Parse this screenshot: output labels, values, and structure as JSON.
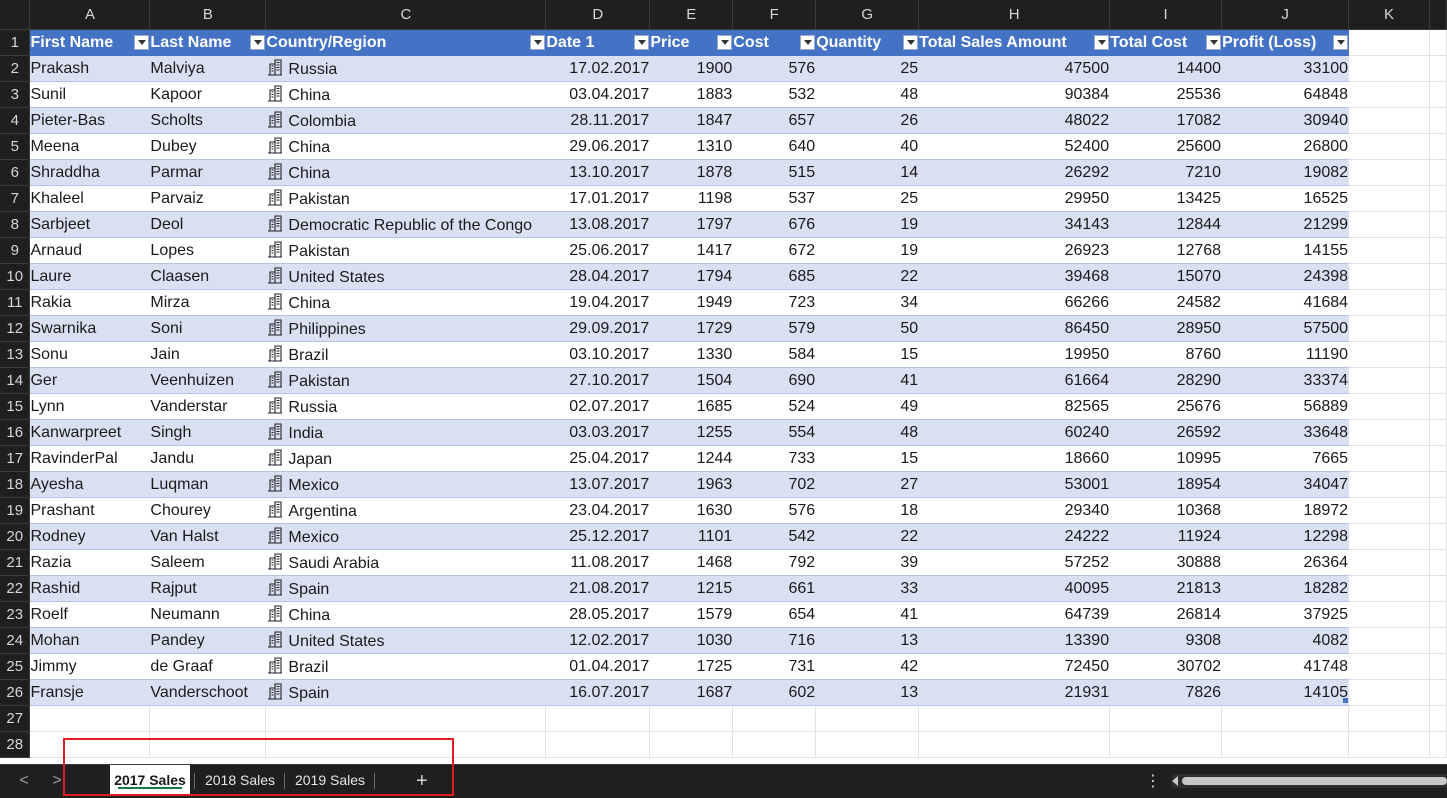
{
  "columns": [
    "A",
    "B",
    "C",
    "D",
    "E",
    "F",
    "G",
    "H",
    "I",
    "J",
    "K"
  ],
  "row_numbers": [
    "1",
    "2",
    "3",
    "4",
    "5",
    "6",
    "7",
    "8",
    "9",
    "10",
    "11",
    "12",
    "13",
    "14",
    "15",
    "16",
    "17",
    "18",
    "19",
    "20",
    "21",
    "22",
    "23",
    "24",
    "25",
    "26",
    "27",
    "28"
  ],
  "table": {
    "headers": [
      "First Name",
      "Last Name",
      "Country/Region",
      "Date 1",
      "Price",
      "Cost",
      "Quantity",
      "Total Sales Amount",
      "Total Cost",
      "Profit (Loss)"
    ],
    "rows": [
      [
        "Prakash",
        "Malviya",
        "Russia",
        "17.02.2017",
        "1900",
        "576",
        "25",
        "47500",
        "14400",
        "33100"
      ],
      [
        "Sunil",
        "Kapoor",
        "China",
        "03.04.2017",
        "1883",
        "532",
        "48",
        "90384",
        "25536",
        "64848"
      ],
      [
        "Pieter-Bas",
        "Scholts",
        "Colombia",
        "28.11.2017",
        "1847",
        "657",
        "26",
        "48022",
        "17082",
        "30940"
      ],
      [
        "Meena",
        "Dubey",
        "China",
        "29.06.2017",
        "1310",
        "640",
        "40",
        "52400",
        "25600",
        "26800"
      ],
      [
        "Shraddha",
        "Parmar",
        "China",
        "13.10.2017",
        "1878",
        "515",
        "14",
        "26292",
        "7210",
        "19082"
      ],
      [
        "Khaleel",
        "Parvaiz",
        "Pakistan",
        "17.01.2017",
        "1198",
        "537",
        "25",
        "29950",
        "13425",
        "16525"
      ],
      [
        "Sarbjeet",
        "Deol",
        "Democratic Republic of the Congo",
        "13.08.2017",
        "1797",
        "676",
        "19",
        "34143",
        "12844",
        "21299"
      ],
      [
        "Arnaud",
        "Lopes",
        "Pakistan",
        "25.06.2017",
        "1417",
        "672",
        "19",
        "26923",
        "12768",
        "14155"
      ],
      [
        "Laure",
        "Claasen",
        "United States",
        "28.04.2017",
        "1794",
        "685",
        "22",
        "39468",
        "15070",
        "24398"
      ],
      [
        "Rakia",
        "Mirza",
        "China",
        "19.04.2017",
        "1949",
        "723",
        "34",
        "66266",
        "24582",
        "41684"
      ],
      [
        "Swarnika",
        "Soni",
        "Philippines",
        "29.09.2017",
        "1729",
        "579",
        "50",
        "86450",
        "28950",
        "57500"
      ],
      [
        "Sonu",
        "Jain",
        "Brazil",
        "03.10.2017",
        "1330",
        "584",
        "15",
        "19950",
        "8760",
        "11190"
      ],
      [
        "Ger",
        "Veenhuizen",
        "Pakistan",
        "27.10.2017",
        "1504",
        "690",
        "41",
        "61664",
        "28290",
        "33374"
      ],
      [
        "Lynn",
        "Vanderstar",
        "Russia",
        "02.07.2017",
        "1685",
        "524",
        "49",
        "82565",
        "25676",
        "56889"
      ],
      [
        "Kanwarpreet",
        "Singh",
        "India",
        "03.03.2017",
        "1255",
        "554",
        "48",
        "60240",
        "26592",
        "33648"
      ],
      [
        "RavinderPal",
        "Jandu",
        "Japan",
        "25.04.2017",
        "1244",
        "733",
        "15",
        "18660",
        "10995",
        "7665"
      ],
      [
        "Ayesha",
        "Luqman",
        "Mexico",
        "13.07.2017",
        "1963",
        "702",
        "27",
        "53001",
        "18954",
        "34047"
      ],
      [
        "Prashant",
        "Chourey",
        "Argentina",
        "23.04.2017",
        "1630",
        "576",
        "18",
        "29340",
        "10368",
        "18972"
      ],
      [
        "Rodney",
        "Van Halst",
        "Mexico",
        "25.12.2017",
        "1101",
        "542",
        "22",
        "24222",
        "11924",
        "12298"
      ],
      [
        "Razia",
        "Saleem",
        "Saudi Arabia",
        "11.08.2017",
        "1468",
        "792",
        "39",
        "57252",
        "30888",
        "26364"
      ],
      [
        "Rashid",
        "Rajput",
        "Spain",
        "21.08.2017",
        "1215",
        "661",
        "33",
        "40095",
        "21813",
        "18282"
      ],
      [
        "Roelf",
        "Neumann",
        "China",
        "28.05.2017",
        "1579",
        "654",
        "41",
        "64739",
        "26814",
        "37925"
      ],
      [
        "Mohan",
        "Pandey",
        "United States",
        "12.02.2017",
        "1030",
        "716",
        "13",
        "13390",
        "9308",
        "4082"
      ],
      [
        "Jimmy",
        "de Graaf",
        "Brazil",
        "01.04.2017",
        "1725",
        "731",
        "42",
        "72450",
        "30702",
        "41748"
      ],
      [
        "Fransje",
        "Vanderschoot",
        "Spain",
        "16.07.2017",
        "1687",
        "602",
        "13",
        "21931",
        "7826",
        "14105"
      ]
    ]
  },
  "sheet_tabs": [
    {
      "label": "2017 Sales",
      "active": true
    },
    {
      "label": "2018 Sales",
      "active": false
    },
    {
      "label": "2019 Sales",
      "active": false
    }
  ],
  "tabbar": {
    "prev": "<",
    "next": ">",
    "add": "+",
    "options": "⋮"
  },
  "colors": {
    "header_fill": "#4472c4",
    "band_fill": "#d9e0f2",
    "active_tab_underline": "#107c41",
    "highlight_box": "#e01b24"
  },
  "icons": {
    "geography": "geography-data-type-icon",
    "filter": "filter-dropdown-icon"
  }
}
